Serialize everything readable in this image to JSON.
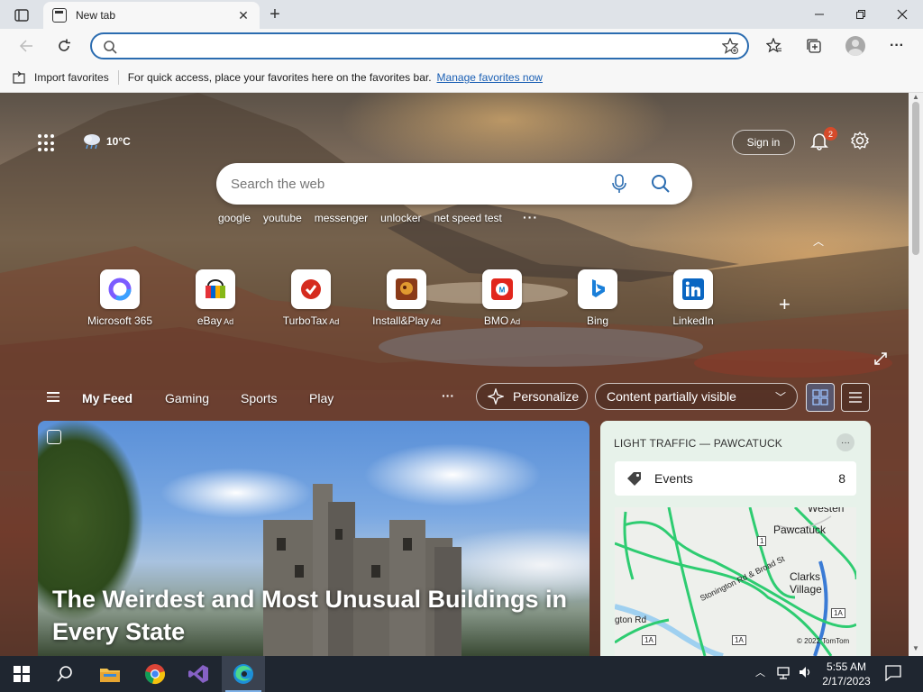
{
  "browser": {
    "tab_title": "New tab",
    "address_placeholder": "",
    "favorites_bar": {
      "import_label": "Import favorites",
      "message": "For quick access, place your favorites here on the favorites bar.",
      "manage_link": "Manage favorites now"
    }
  },
  "newtab": {
    "weather": "10°C",
    "signin_label": "Sign in",
    "notification_count": "2",
    "search_placeholder": "Search the web",
    "trending": [
      "google",
      "youtube",
      "messenger",
      "unlocker",
      "net speed test"
    ],
    "tiles": [
      {
        "label": "Microsoft 365",
        "ad": ""
      },
      {
        "label": "eBay",
        "ad": "Ad"
      },
      {
        "label": "TurboTax",
        "ad": "Ad"
      },
      {
        "label": "Install&Play",
        "ad": "Ad"
      },
      {
        "label": "BMO",
        "ad": "Ad"
      },
      {
        "label": "Bing",
        "ad": ""
      },
      {
        "label": "LinkedIn",
        "ad": ""
      }
    ],
    "feed_tabs": [
      "My Feed",
      "Gaming",
      "Sports",
      "Play"
    ],
    "personalize_label": "Personalize",
    "content_visibility": "Content partially visible",
    "headline": "The Weirdest and Most Unusual Buildings in Every State",
    "traffic": {
      "title": "LIGHT TRAFFIC — PAWCATUCK",
      "events_label": "Events",
      "events_count": "8",
      "map_labels": [
        "Westerl",
        "Pawcatuck",
        "Clarks Village",
        "Stonington Rd & Broad St",
        "gton Rd",
        "© 2022 TomTom"
      ],
      "route_shields": [
        "1",
        "1A",
        "1A",
        "1A"
      ]
    }
  },
  "taskbar": {
    "time": "5:55 AM",
    "date": "2/17/2023"
  },
  "colors": {
    "accent": "#2b6cb0",
    "link": "#1a5fb4",
    "badge": "#d64a2a",
    "taskbar": "#1f2630"
  }
}
